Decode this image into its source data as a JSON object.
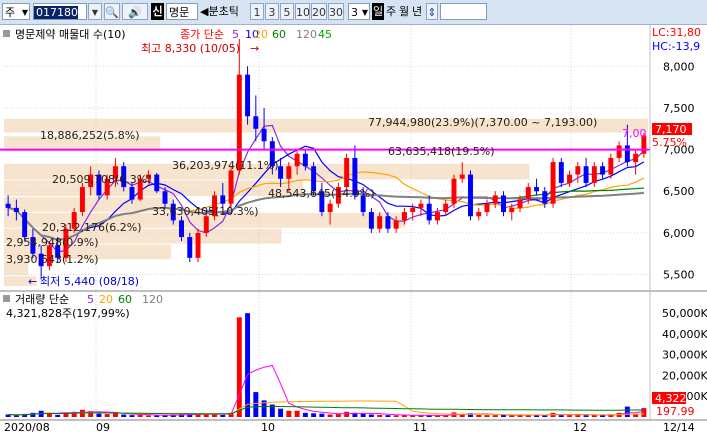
{
  "toolbar": {
    "market_type": "주",
    "stock_code": "017180",
    "stock_name": "명문",
    "stock_badge": "신",
    "period_label": "분초틱",
    "minute_options": [
      "1",
      "3",
      "5",
      "10",
      "20",
      "30"
    ],
    "count_value": "3",
    "periods": [
      "일",
      "주",
      "월",
      "년"
    ],
    "active_period": "일"
  },
  "price_panel": {
    "title": "명문제약 매물대 수(10)",
    "ma_label": "종가 단순",
    "ma_periods": [
      "5",
      "10",
      "20",
      "60",
      "120",
      "45"
    ],
    "ma_colors": [
      "#8a2be2",
      "#0000ff",
      "#ffa500",
      "#008000",
      "#808080",
      "#00aa00"
    ],
    "lc_label": "LC:31,80",
    "hc_label": "HC:-13,9",
    "high_label": "최고 8,330 (10/05)",
    "low_label": "최저 5,440 (08/18)",
    "current_price": "7,170",
    "current_change": "5.75%",
    "ref_price": "7,00",
    "y_ticks": [
      "8,000",
      "7,500",
      "7,000",
      "6,500",
      "6,000",
      "5,500"
    ]
  },
  "volume_panel": {
    "title": "거래량 단순",
    "ma_periods": [
      "5",
      "20",
      "60",
      "120"
    ],
    "value_label": "4,321,828주(197,99%)",
    "y_ticks": [
      "50,000K",
      "40,000K",
      "30,000K",
      "20,000K",
      "10,000K"
    ],
    "current_volume": "4,322",
    "current_pct": "197.99"
  },
  "volume_profile": [
    {
      "label": "77,944,980(23.9%)(7,370.00 ~ 7,193.00)"
    },
    {
      "label": "18,886,252(5.8%)"
    },
    {
      "label": "63,635,418(19.5%)"
    },
    {
      "label": "36,203,974(11.1%)"
    },
    {
      "label": "20,509,708(6.3%)"
    },
    {
      "label": "48,543,645(14.9%)"
    },
    {
      "label": "33,630,405(10.3%)"
    },
    {
      "label": "20,312,176(6.2%)"
    },
    {
      "label": "2,954,948(0.9%)"
    },
    {
      "label": "3,930,543(1.2%)"
    }
  ],
  "x_labels": [
    "2020/08",
    "09",
    "10",
    "11",
    "12",
    "12/14"
  ],
  "chart_data": {
    "type": "candlestick",
    "ylim": [
      5350,
      8400
    ],
    "ref_line": 7000,
    "profile_bands": [
      {
        "lo": 7193,
        "hi": 7370,
        "pct": 23.9
      },
      {
        "lo": 6970,
        "hi": 7160,
        "pct": 5.8
      },
      {
        "lo": 6630,
        "hi": 6830,
        "pct": 19.5
      },
      {
        "lo": 6430,
        "hi": 6630,
        "pct": 11.1
      },
      {
        "lo": 6240,
        "hi": 6430,
        "pct": 6.3
      },
      {
        "lo": 6050,
        "hi": 6240,
        "pct": 14.9
      },
      {
        "lo": 5860,
        "hi": 6050,
        "pct": 10.3
      },
      {
        "lo": 5670,
        "hi": 5860,
        "pct": 6.2
      },
      {
        "lo": 5480,
        "hi": 5670,
        "pct": 0.9
      },
      {
        "lo": 5350,
        "hi": 5480,
        "pct": 1.2
      }
    ],
    "candles": [
      [
        6350,
        6450,
        6200,
        6300,
        1.2
      ],
      [
        6300,
        6400,
        6150,
        6250,
        0.8
      ],
      [
        6250,
        6280,
        5900,
        5950,
        1.5
      ],
      [
        5950,
        6050,
        5700,
        5750,
        2.0
      ],
      [
        5750,
        5850,
        5440,
        5600,
        3.0
      ],
      [
        5600,
        5900,
        5550,
        5850,
        1.8
      ],
      [
        5850,
        5950,
        5650,
        5700,
        1.0
      ],
      [
        5700,
        6100,
        5650,
        6050,
        2.2
      ],
      [
        6050,
        6300,
        6000,
        6250,
        2.5
      ],
      [
        6250,
        6600,
        6200,
        6550,
        3.5
      ],
      [
        6550,
        6800,
        6450,
        6700,
        2.8
      ],
      [
        6700,
        6750,
        6400,
        6450,
        1.6
      ],
      [
        6450,
        6700,
        6400,
        6650,
        1.4
      ],
      [
        6650,
        6900,
        6550,
        6800,
        1.8
      ],
      [
        6800,
        6850,
        6500,
        6550,
        1.2
      ],
      [
        6550,
        6600,
        6350,
        6400,
        0.9
      ],
      [
        6400,
        6700,
        6380,
        6650,
        1.1
      ],
      [
        6650,
        6750,
        6600,
        6700,
        0.8
      ],
      [
        6700,
        6720,
        6480,
        6500,
        0.7
      ],
      [
        6500,
        6550,
        6300,
        6350,
        0.9
      ],
      [
        6350,
        6400,
        6100,
        6150,
        1.0
      ],
      [
        6150,
        6200,
        5900,
        5950,
        1.3
      ],
      [
        5950,
        6000,
        5650,
        5700,
        1.6
      ],
      [
        5700,
        6050,
        5650,
        6000,
        1.4
      ],
      [
        6000,
        6250,
        5950,
        6200,
        1.2
      ],
      [
        6200,
        6500,
        6150,
        6450,
        1.5
      ],
      [
        6450,
        6600,
        6300,
        6350,
        1.0
      ],
      [
        6350,
        6800,
        6300,
        6750,
        2.0
      ],
      [
        6750,
        8330,
        6700,
        7900,
        48.0
      ],
      [
        7900,
        8000,
        7300,
        7400,
        50.0
      ],
      [
        7400,
        7650,
        7100,
        7250,
        12.0
      ],
      [
        7250,
        7500,
        7000,
        7100,
        8.0
      ],
      [
        7100,
        7150,
        6700,
        6800,
        6.0
      ],
      [
        6800,
        6900,
        6550,
        6650,
        4.0
      ],
      [
        6650,
        6850,
        6500,
        6800,
        3.0
      ],
      [
        6800,
        7000,
        6700,
        6950,
        3.0
      ],
      [
        6950,
        7000,
        6750,
        6800,
        2.0
      ],
      [
        6800,
        6850,
        6450,
        6500,
        1.8
      ],
      [
        6500,
        6600,
        6200,
        6250,
        1.6
      ],
      [
        6250,
        6400,
        6100,
        6350,
        1.2
      ],
      [
        6350,
        6600,
        6300,
        6550,
        1.4
      ],
      [
        6550,
        6950,
        6500,
        6900,
        2.5
      ],
      [
        6900,
        7050,
        6400,
        6450,
        2.0
      ],
      [
        6450,
        6550,
        6200,
        6250,
        1.6
      ],
      [
        6250,
        6300,
        6000,
        6050,
        1.2
      ],
      [
        6050,
        6250,
        6000,
        6200,
        1.0
      ],
      [
        6200,
        6250,
        6000,
        6050,
        0.9
      ],
      [
        6050,
        6200,
        6000,
        6150,
        0.8
      ],
      [
        6150,
        6300,
        6100,
        6250,
        0.8
      ],
      [
        6250,
        6350,
        6150,
        6300,
        0.7
      ],
      [
        6300,
        6400,
        6200,
        6350,
        0.8
      ],
      [
        6350,
        6450,
        6100,
        6150,
        0.9
      ],
      [
        6150,
        6300,
        6100,
        6250,
        0.7
      ],
      [
        6250,
        6400,
        6200,
        6350,
        0.8
      ],
      [
        6350,
        6700,
        6300,
        6650,
        2.2
      ],
      [
        6650,
        6850,
        6600,
        6700,
        1.5
      ],
      [
        6700,
        6750,
        6150,
        6200,
        1.8
      ],
      [
        6200,
        6300,
        6150,
        6250,
        1.0
      ],
      [
        6250,
        6400,
        6200,
        6350,
        0.9
      ],
      [
        6350,
        6500,
        6300,
        6450,
        0.9
      ],
      [
        6450,
        6500,
        6200,
        6250,
        1.0
      ],
      [
        6250,
        6350,
        6150,
        6300,
        0.8
      ],
      [
        6300,
        6450,
        6250,
        6400,
        0.8
      ],
      [
        6400,
        6600,
        6350,
        6550,
        1.2
      ],
      [
        6550,
        6650,
        6450,
        6500,
        1.0
      ],
      [
        6500,
        6550,
        6300,
        6350,
        0.8
      ],
      [
        6350,
        6900,
        6300,
        6850,
        2.0
      ],
      [
        6850,
        6900,
        6550,
        6600,
        1.2
      ],
      [
        6600,
        6750,
        6550,
        6700,
        1.0
      ],
      [
        6700,
        6850,
        6600,
        6800,
        1.0
      ],
      [
        6800,
        6900,
        6550,
        6600,
        0.9
      ],
      [
        6600,
        6850,
        6550,
        6800,
        1.0
      ],
      [
        6800,
        6850,
        6650,
        6700,
        0.8
      ],
      [
        6700,
        6950,
        6650,
        6900,
        1.2
      ],
      [
        6900,
        7100,
        6850,
        7050,
        2.0
      ],
      [
        7050,
        7300,
        6800,
        6850,
        5.0
      ],
      [
        6850,
        7000,
        6700,
        6950,
        1.5
      ],
      [
        6950,
        7200,
        6900,
        7170,
        4.3
      ]
    ]
  }
}
